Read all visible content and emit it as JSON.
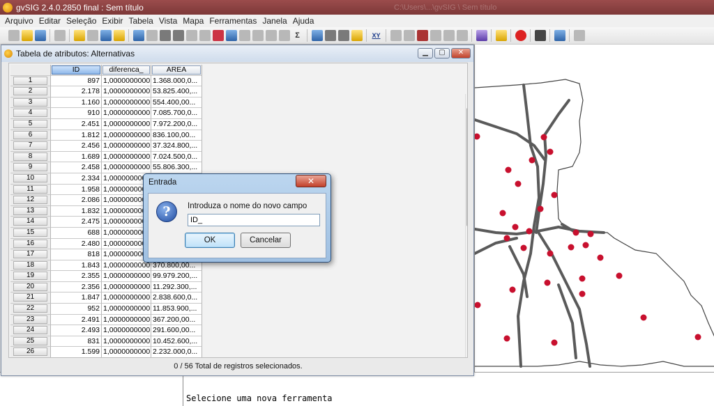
{
  "app": {
    "title": "gvSIG 2.4.0.2850 final : Sem título",
    "background_title": "C:\\Users\\...\\gvSIG \\ Sem título"
  },
  "menu": [
    "Arquivo",
    "Editar",
    "Seleção",
    "Exibir",
    "Tabela",
    "Vista",
    "Mapa",
    "Ferramentas",
    "Janela",
    "Ajuda"
  ],
  "toolbar": {
    "icons": [
      "new-doc-icon",
      "open-icon",
      "save-icon",
      "print-icon",
      "refresh-icon",
      "pan-icon",
      "sort-icon",
      "filter-icon",
      "table-icon",
      "order-icon",
      "sum-icon",
      "xy-icon",
      "undo-icon",
      "redo-icon",
      "cut-icon",
      "copy-icon",
      "paste-icon",
      "layer-icon",
      "plugin-icon",
      "error-icon",
      "tools-icon",
      "user-icon",
      "info-icon"
    ],
    "xy_label": "XY",
    "sum_label": "Σ"
  },
  "table_window": {
    "title": "Tabela de atributos: Alternativas",
    "columns": [
      "ID",
      "diferenca_",
      "AREA"
    ],
    "rows": [
      [
        "1",
        "897",
        "1,0000000000",
        "1.368.000,0..."
      ],
      [
        "2",
        "2.178",
        "1,0000000000",
        "53.825.400,..."
      ],
      [
        "3",
        "1.160",
        "1,0000000000",
        " 554.400,00..."
      ],
      [
        "4",
        "910",
        "1,0000000000",
        "7.085.700,0..."
      ],
      [
        "5",
        "2.451",
        "1,0000000000",
        "7.972.200,0..."
      ],
      [
        "6",
        "1.812",
        "1,0000000000",
        " 836.100,00..."
      ],
      [
        "7",
        "2.456",
        "1,0000000000",
        "37.324.800,..."
      ],
      [
        "8",
        "1.689",
        "1,0000000000",
        "7.024.500,0..."
      ],
      [
        "9",
        "2.458",
        "1,0000000000",
        "55.806.300,..."
      ],
      [
        "10",
        "2.334",
        "1,0000000000",
        ""
      ],
      [
        "11",
        "1.958",
        "1,0000000000",
        ""
      ],
      [
        "12",
        "2.086",
        "1,0000000000",
        ""
      ],
      [
        "13",
        "1.832",
        "1,0000000000",
        ""
      ],
      [
        "14",
        "2.475",
        "1,0000000000",
        ""
      ],
      [
        "15",
        "688",
        "1,0000000000",
        ""
      ],
      [
        "16",
        "2.480",
        "1,0000000000",
        ""
      ],
      [
        "17",
        "818",
        "1,0000000000",
        ""
      ],
      [
        "18",
        "1.843",
        "1,0000000000",
        " 370.800,00..."
      ],
      [
        "19",
        "2.355",
        "1,0000000000",
        "99.979.200,..."
      ],
      [
        "20",
        "2.356",
        "1,0000000000",
        "11.292.300,..."
      ],
      [
        "21",
        "1.847",
        "1,0000000000",
        "2.838.600,0..."
      ],
      [
        "22",
        "952",
        "1,0000000000",
        "11.853.900,..."
      ],
      [
        "23",
        "2.491",
        "1,0000000000",
        " 367.200,00..."
      ],
      [
        "24",
        "2.493",
        "1,0000000000",
        " 291.600,00..."
      ],
      [
        "25",
        "831",
        "1,0000000000",
        "10.452.600,..."
      ],
      [
        "26",
        "1.599",
        "1,0000000000",
        "2.232.000,0..."
      ]
    ],
    "status": "0 / 56 Total de registros selecionados."
  },
  "dialog": {
    "title": "Entrada",
    "close_label": "X",
    "prompt": "Introduza o nome do novo campo",
    "input_value": "ID_",
    "ok_label": "OK",
    "cancel_label": "Cancelar"
  },
  "console": {
    "message": "Selecione uma nova ferramenta"
  },
  "colors": {
    "titlebar": "#8a4141",
    "point": "#c8102e",
    "road": "#555555"
  }
}
